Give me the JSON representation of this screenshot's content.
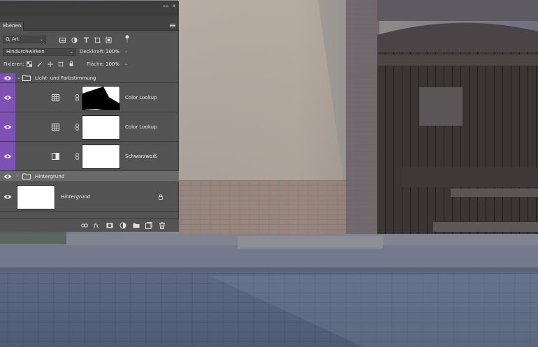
{
  "panel": {
    "tab_label": "Ebenen",
    "top_controls": {
      "collapse": "««",
      "close": "✕"
    },
    "filter": {
      "kind_value": "Art"
    },
    "blend_mode": "Hindurchwirken",
    "opacity": {
      "label": "Deckkraft:",
      "value": "100%"
    },
    "lock": {
      "label": "Fixieren:"
    },
    "fill": {
      "label": "Fläche:",
      "value": "100%"
    }
  },
  "layers": [
    {
      "name": "Licht- und Farbstimmung",
      "type": "group",
      "expanded": true,
      "visible": true
    },
    {
      "name": "Color Lookup",
      "type": "adjustment",
      "icon": "table-grid-icon",
      "visible": true
    },
    {
      "name": "Color Lookup",
      "type": "adjustment",
      "icon": "table-grid-icon",
      "visible": true
    },
    {
      "name": "Schwarzweiß",
      "type": "adjustment",
      "icon": "black-white-icon",
      "visible": true
    },
    {
      "name": "Hintergrund",
      "type": "group",
      "expanded": false,
      "visible": true
    },
    {
      "name": "Hintergrund",
      "type": "background",
      "locked": true,
      "visible": true
    }
  ],
  "colors": {
    "selection_purple": "#7e52b5",
    "panel_bg": "#535353"
  }
}
